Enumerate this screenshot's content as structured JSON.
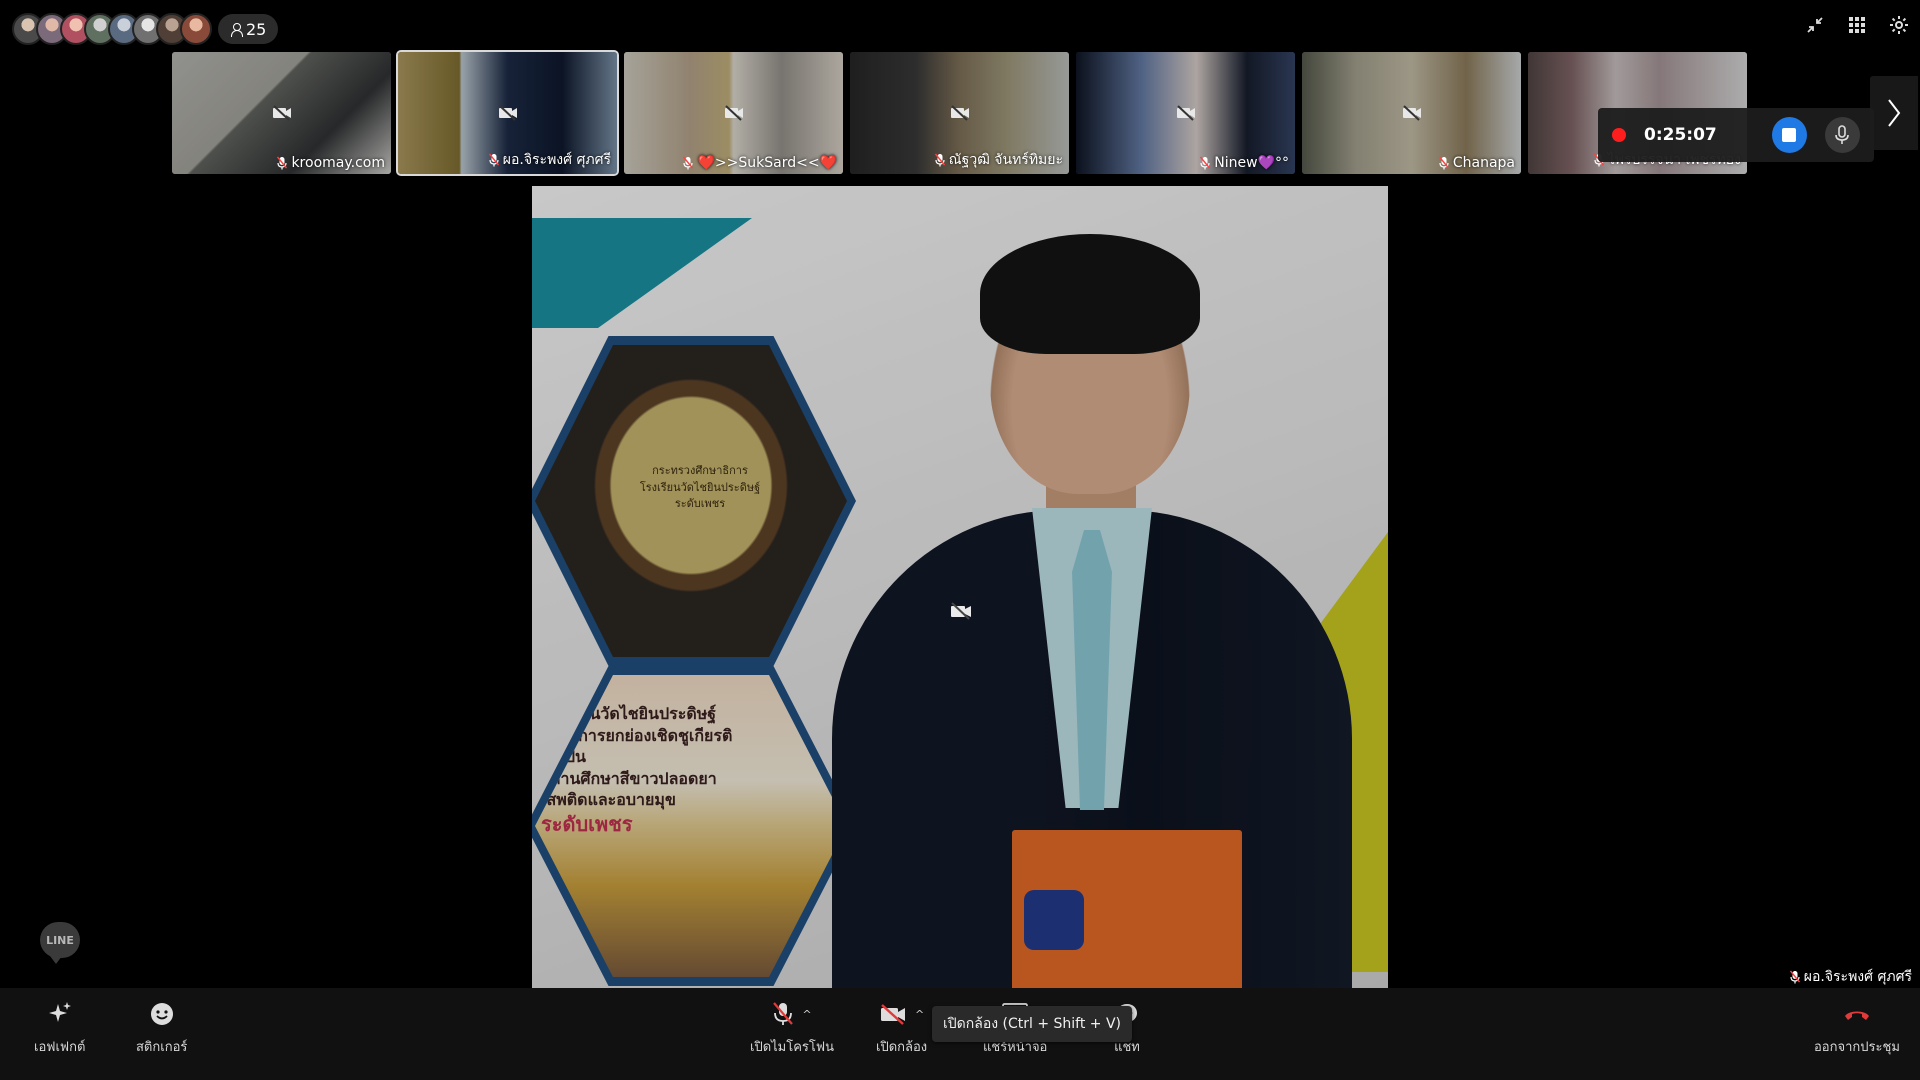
{
  "participants": {
    "avatar_count_shown": 8,
    "count": "25"
  },
  "strip": {
    "tiles": [
      {
        "name": "kroomay.com"
      },
      {
        "name": "ผอ.จิระพงศ์ ศุภศรี"
      },
      {
        "name": "❤️>>SukSard<<❤️"
      },
      {
        "name": "ณัฐวุฒิ จันทร์ทิมยะ"
      },
      {
        "name": "Ninew💜°°"
      },
      {
        "name": "Chanapa"
      },
      {
        "name": "ไพรบรรจนา เพชรทอง"
      }
    ]
  },
  "recording": {
    "time": "0:25:07"
  },
  "main": {
    "speaker_name": "ผอ.จิระพงศ์ ศุภศรี",
    "plaque_lines": [
      "กระทรวงศึกษาธิการ",
      "โรงเรียนวัดไชยินประดิษฐ์",
      "ระดับเพชร"
    ],
    "poster_lines": [
      "โรงเรียนวัดไชยินประดิษฐ์",
      "ได้รับการยกย่องเชิดชูเกียรติให้เป็น",
      "สถานศึกษาสีขาวปลอดยาเสพติดและอบายมุข"
    ],
    "poster_highlight": "ระดับเพชร"
  },
  "line_bubble": {
    "label": "LINE"
  },
  "toolbar": {
    "effects": "เอฟเฟกต์",
    "stickers": "สติกเกอร์",
    "mic": "เปิดไมโครโฟน",
    "camera": "เปิดกล้อง",
    "share": "แชร์หน้าจอ",
    "chat": "แชท",
    "leave": "ออกจากประชุม"
  },
  "tooltip": {
    "camera": "เปิดกล้อง (Ctrl + Shift + V)"
  },
  "colors": {
    "record": "#ff1e1e",
    "stop": "#1f7ae6",
    "leave": "#e23a3a"
  }
}
